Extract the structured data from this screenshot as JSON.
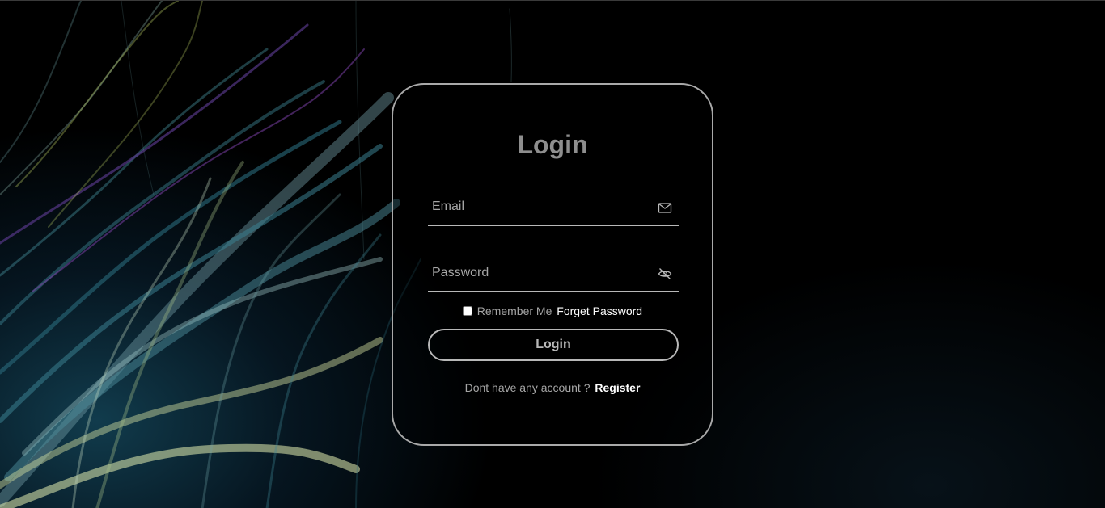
{
  "login_form": {
    "title": "Login",
    "email": {
      "placeholder": "Email",
      "value": "",
      "icon": "mail-icon"
    },
    "password": {
      "placeholder": "Password",
      "value": "",
      "icon": "eye-off-icon"
    },
    "remember_label": "Remember Me",
    "remember_checked": false,
    "forget_label": "Forget Password",
    "submit_label": "Login",
    "register_prompt": "Dont have any account ?",
    "register_label": "Register"
  },
  "colors": {
    "border": "#a9a9a9",
    "title": "#8e8e8e",
    "muted_text": "#a5a5a5",
    "link": "#ffffff",
    "background": "#000000",
    "accent_teal": "#2a6b7c"
  }
}
